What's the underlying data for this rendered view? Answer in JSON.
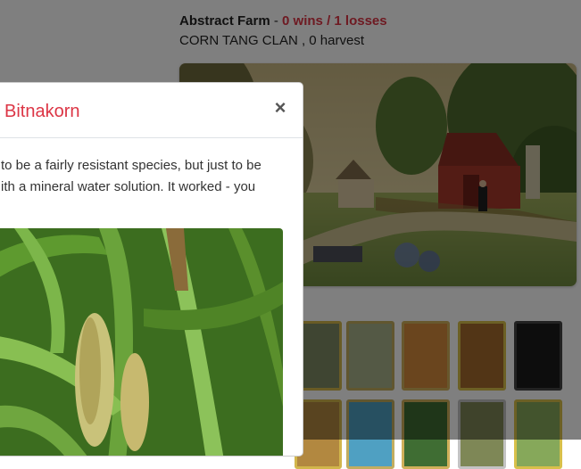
{
  "farm": {
    "name": "Abstract Farm",
    "separator": " - ",
    "record": "0 wins / 1 losses",
    "subtitle": "CORN TANG CLAN , 0 harvest"
  },
  "modal": {
    "title": "Bitnakorn",
    "close_label": "×",
    "text_line_1": "to be a fairly resistant species, but just to be",
    "text_line_2": "ith a mineral water solution. It worked - you"
  },
  "colors": {
    "accent_red": "#dc3545",
    "backdrop": "rgba(0,0,0,0.5)"
  },
  "icons": {
    "close": "close-icon"
  }
}
